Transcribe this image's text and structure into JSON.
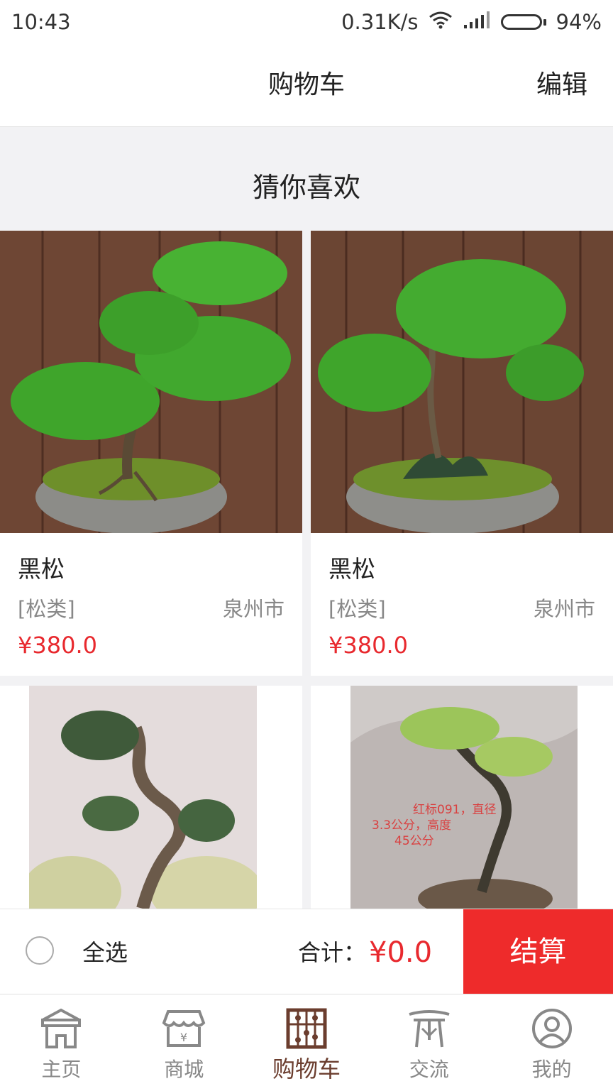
{
  "status_bar": {
    "time": "10:43",
    "network_speed": "0.31K/s",
    "battery_percent": "94%",
    "battery_level": 0.94,
    "icons": [
      "wifi-icon",
      "signal-icon",
      "battery-icon"
    ]
  },
  "header": {
    "title": "购物车",
    "edit_label": "编辑"
  },
  "recommend": {
    "title": "猜你喜欢",
    "items": [
      {
        "name": "黑松",
        "category": "[松类]",
        "city": "泉州市",
        "price": "¥380.0"
      },
      {
        "name": "黑松",
        "category": "[松类]",
        "city": "泉州市",
        "price": "¥380.0"
      },
      {
        "name": "",
        "category": "",
        "city": "",
        "price": ""
      },
      {
        "name": "",
        "category": "",
        "city": "",
        "price": ""
      }
    ],
    "photo_overlay_text": {
      "line1": "红标091，直径",
      "line2": "3.3公分，高度",
      "line3": "45公分"
    }
  },
  "checkout": {
    "select_all_label": "全选",
    "total_label": "合计：",
    "total_value": "¥0.0",
    "checkout_label": "结算"
  },
  "tabs": [
    {
      "label": "主页",
      "icon": "home-icon",
      "active": false
    },
    {
      "label": "商城",
      "icon": "shop-icon",
      "active": false
    },
    {
      "label": "购物车",
      "icon": "cart-abacus-icon",
      "active": true
    },
    {
      "label": "交流",
      "icon": "community-icon",
      "active": false
    },
    {
      "label": "我的",
      "icon": "profile-icon",
      "active": false
    }
  ],
  "colors": {
    "accent_red": "#e8292e",
    "checkout_red": "#ee2b2b",
    "active_tab_brown": "#6b3d2e"
  }
}
